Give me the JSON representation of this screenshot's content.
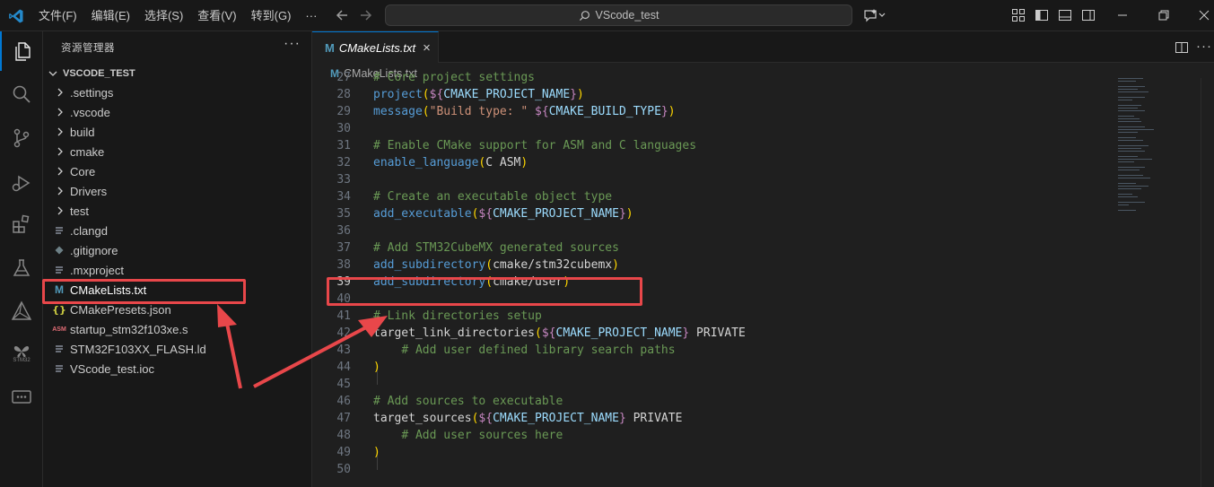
{
  "titlebar": {
    "menu": [
      "文件(F)",
      "编辑(E)",
      "选择(S)",
      "查看(V)",
      "转到(G)",
      "···"
    ],
    "search": "VScode_test"
  },
  "sidebar": {
    "title": "资源管理器",
    "more": "···",
    "root": "VSCODE_TEST",
    "items": [
      {
        "label": ".settings",
        "type": "folder"
      },
      {
        "label": ".vscode",
        "type": "folder"
      },
      {
        "label": "build",
        "type": "folder"
      },
      {
        "label": "cmake",
        "type": "folder"
      },
      {
        "label": "Core",
        "type": "folder"
      },
      {
        "label": "Drivers",
        "type": "folder"
      },
      {
        "label": "test",
        "type": "folder"
      },
      {
        "label": ".clangd",
        "type": "lines"
      },
      {
        "label": ".gitignore",
        "type": "git"
      },
      {
        "label": ".mxproject",
        "type": "lines"
      },
      {
        "label": "CMakeLists.txt",
        "type": "cmake"
      },
      {
        "label": "CMakePresets.json",
        "type": "json"
      },
      {
        "label": "startup_stm32f103xe.s",
        "type": "asm"
      },
      {
        "label": "STM32F103XX_FLASH.ld",
        "type": "lines"
      },
      {
        "label": "VScode_test.ioc",
        "type": "lines"
      }
    ]
  },
  "activity_bar": {
    "stm32_label": "STM32"
  },
  "editor": {
    "tab_label": "CMakeLists.txt",
    "tab_icon_text": "M",
    "tab_close": "×",
    "breadcrumb": "CMakeLists.txt",
    "lines": [
      {
        "n": "27",
        "tokens": [
          [
            "com",
            "# Core project settings"
          ]
        ]
      },
      {
        "n": "28",
        "tokens": [
          [
            "fn2",
            "project"
          ],
          [
            "pr",
            "("
          ],
          [
            "usr",
            "${"
          ],
          [
            "var",
            "CMAKE_PROJECT_NAME"
          ],
          [
            "usr",
            "}"
          ],
          [
            "pr",
            ")"
          ]
        ]
      },
      {
        "n": "29",
        "tokens": [
          [
            "fn2",
            "message"
          ],
          [
            "pr",
            "("
          ],
          [
            "str",
            "\"Build type: \" "
          ],
          [
            "usr",
            "${"
          ],
          [
            "var",
            "CMAKE_BUILD_TYPE"
          ],
          [
            "usr",
            "}"
          ],
          [
            "pr",
            ")"
          ]
        ]
      },
      {
        "n": "30",
        "tokens": []
      },
      {
        "n": "31",
        "tokens": [
          [
            "com",
            "# Enable CMake support for ASM and C languages"
          ]
        ]
      },
      {
        "n": "32",
        "tokens": [
          [
            "fn2",
            "enable_language"
          ],
          [
            "pr",
            "("
          ],
          [
            "plain",
            "C ASM"
          ],
          [
            "pr",
            ")"
          ]
        ]
      },
      {
        "n": "33",
        "tokens": []
      },
      {
        "n": "34",
        "tokens": [
          [
            "com",
            "# Create an executable object type"
          ]
        ]
      },
      {
        "n": "35",
        "tokens": [
          [
            "fn2",
            "add_executable"
          ],
          [
            "pr",
            "("
          ],
          [
            "usr",
            "${"
          ],
          [
            "var",
            "CMAKE_PROJECT_NAME"
          ],
          [
            "usr",
            "}"
          ],
          [
            "pr",
            ")"
          ]
        ]
      },
      {
        "n": "36",
        "tokens": []
      },
      {
        "n": "37",
        "tokens": [
          [
            "com",
            "# Add STM32CubeMX generated sources"
          ]
        ]
      },
      {
        "n": "38",
        "tokens": [
          [
            "fn2",
            "add_subdirectory"
          ],
          [
            "pr",
            "("
          ],
          [
            "plain",
            "cmake/stm32cubemx"
          ],
          [
            "pr",
            ")"
          ]
        ]
      },
      {
        "n": "39",
        "tokens": [
          [
            "fn2",
            "add_subdirectory"
          ],
          [
            "pr",
            "("
          ],
          [
            "plain",
            "cmake/user"
          ],
          [
            "pr",
            ")"
          ]
        ]
      },
      {
        "n": "40",
        "tokens": []
      },
      {
        "n": "41",
        "tokens": [
          [
            "com",
            "# Link directories setup"
          ]
        ]
      },
      {
        "n": "42",
        "tokens": [
          [
            "plain",
            "target_link_directories"
          ],
          [
            "pr",
            "("
          ],
          [
            "usr",
            "${"
          ],
          [
            "var",
            "CMAKE_PROJECT_NAME"
          ],
          [
            "usr",
            "}"
          ],
          [
            "plain",
            " PRIVATE"
          ]
        ]
      },
      {
        "n": "43",
        "tokens": [
          [
            "plain",
            "    "
          ],
          [
            "com",
            "# Add user defined library search paths"
          ]
        ]
      },
      {
        "n": "44",
        "tokens": [
          [
            "pr",
            ")"
          ]
        ]
      },
      {
        "n": "45",
        "tokens": []
      },
      {
        "n": "46",
        "tokens": [
          [
            "com",
            "# Add sources to executable"
          ]
        ]
      },
      {
        "n": "47",
        "tokens": [
          [
            "plain",
            "target_sources"
          ],
          [
            "pr",
            "("
          ],
          [
            "usr",
            "${"
          ],
          [
            "var",
            "CMAKE_PROJECT_NAME"
          ],
          [
            "usr",
            "}"
          ],
          [
            "plain",
            " PRIVATE"
          ]
        ]
      },
      {
        "n": "48",
        "tokens": [
          [
            "plain",
            "    "
          ],
          [
            "com",
            "# Add user sources here"
          ]
        ]
      },
      {
        "n": "49",
        "tokens": [
          [
            "pr",
            ")"
          ]
        ]
      },
      {
        "n": "50",
        "tokens": []
      }
    ]
  },
  "colors": {
    "accent": "#0078d4",
    "annotation": "#e8474a"
  }
}
